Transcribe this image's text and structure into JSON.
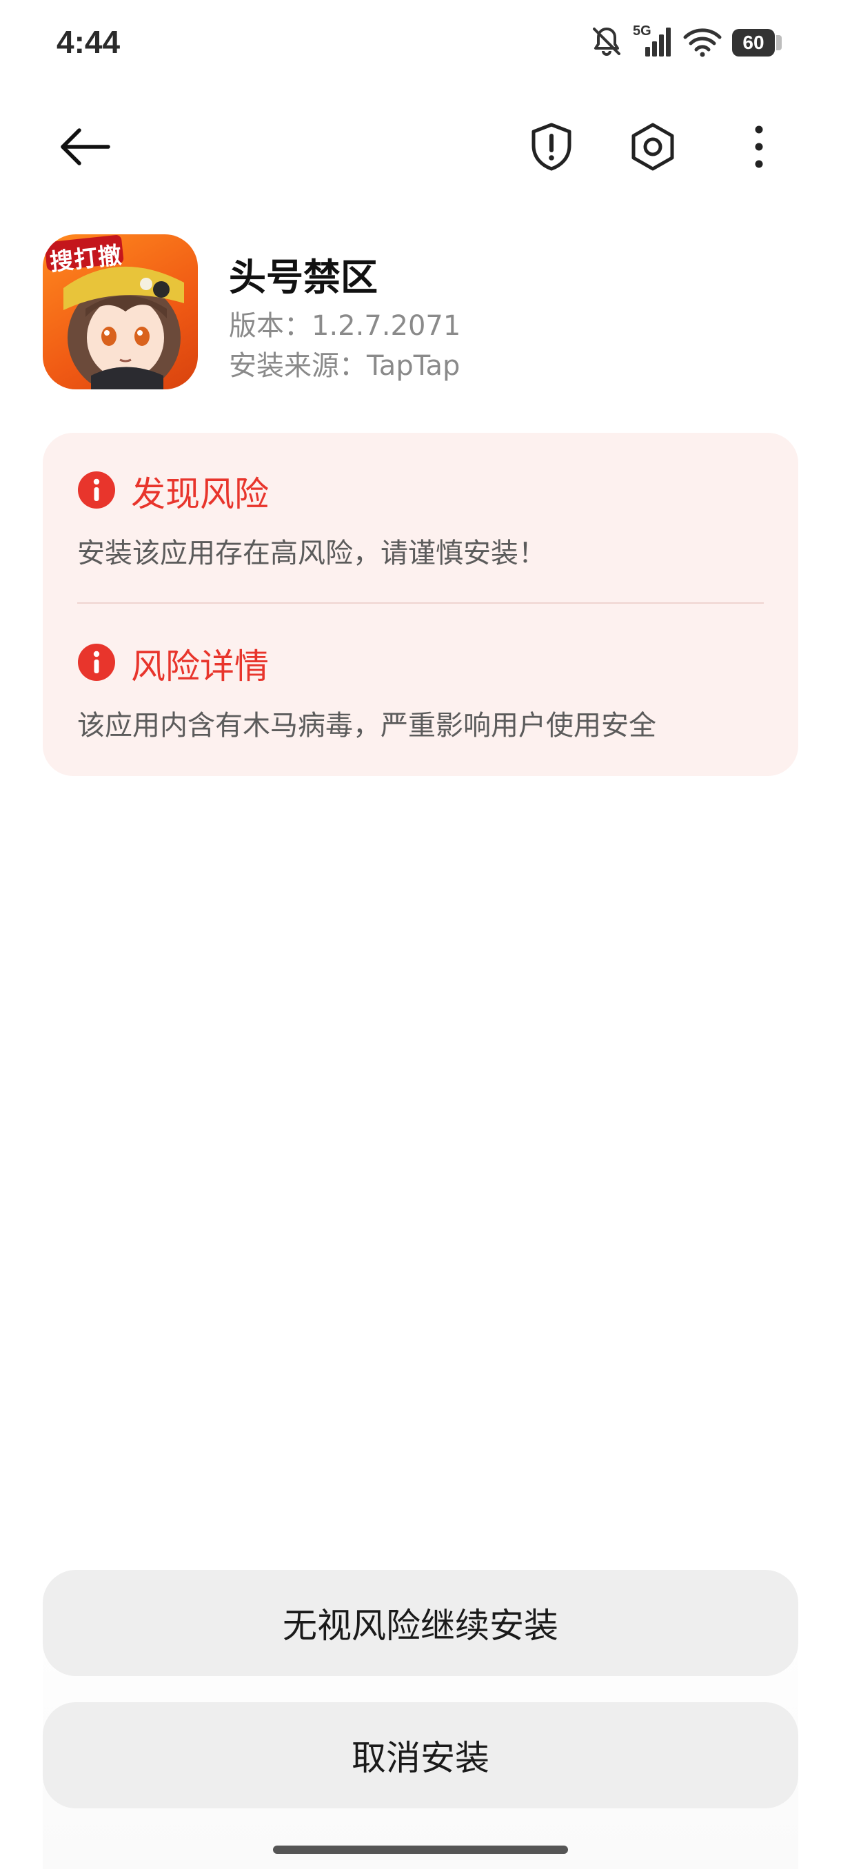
{
  "status_bar": {
    "time": "4:44",
    "network": "5G",
    "battery": "60",
    "icons": [
      "bell-off-icon",
      "signal-5g-icon",
      "wifi-icon",
      "battery-icon"
    ]
  },
  "toolbar": {
    "back_icon": "arrow-left-icon",
    "shield_icon": "shield-alert-icon",
    "settings_icon": "hexagon-settings-icon",
    "more_icon": "more-vertical-icon"
  },
  "app": {
    "name": "头号禁区",
    "version": "版本：1.2.7.2071",
    "source": "安装来源：TapTap",
    "icon_badge_text": "搜打撤"
  },
  "risk": {
    "accent_color": "#e8352c",
    "card_color": "#fdf1ef",
    "items": [
      {
        "icon": "info-alert-icon",
        "title": "发现风险",
        "description": "安装该应用存在高风险，请谨慎安装！"
      },
      {
        "icon": "info-alert-icon",
        "title": "风险详情",
        "description": "该应用内含有木马病毒，严重影响用户使用安全"
      }
    ]
  },
  "buttons": {
    "continue_label": "无视风险继续安装",
    "cancel_label": "取消安装"
  }
}
